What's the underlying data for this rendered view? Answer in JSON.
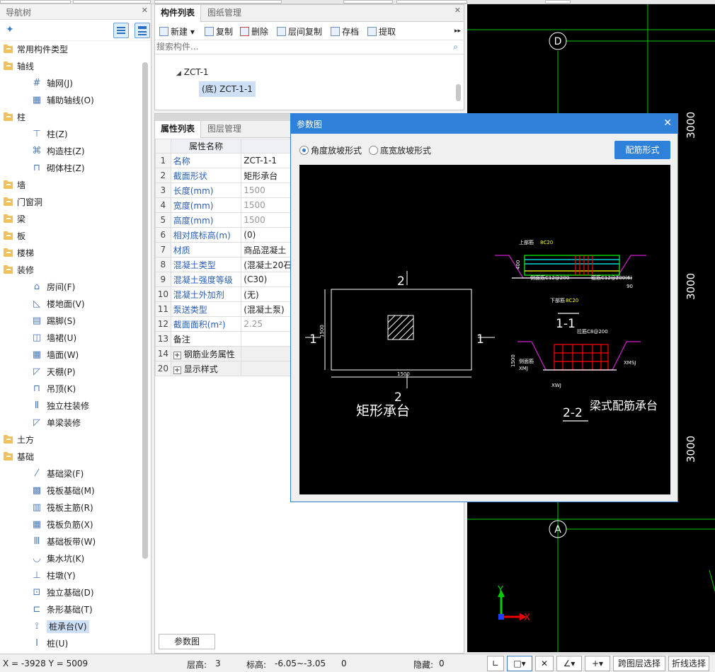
{
  "nav": {
    "title": "导航树",
    "items": [
      {
        "label": "常用构件类型",
        "level": 0
      },
      {
        "label": "轴线",
        "level": 0
      },
      {
        "label": "轴网(J)",
        "level": 1,
        "icon": "grid-icon"
      },
      {
        "label": "辅助轴线(O)",
        "level": 1,
        "icon": "aux-grid-icon"
      },
      {
        "label": "柱",
        "level": 0
      },
      {
        "label": "柱(Z)",
        "level": 1,
        "icon": "column-icon"
      },
      {
        "label": "构造柱(Z)",
        "level": 1,
        "icon": "structural-column-icon"
      },
      {
        "label": "砌体柱(Z)",
        "level": 1,
        "icon": "masonry-column-icon"
      },
      {
        "label": "墙",
        "level": 0
      },
      {
        "label": "门窗洞",
        "level": 0
      },
      {
        "label": "梁",
        "level": 0
      },
      {
        "label": "板",
        "level": 0
      },
      {
        "label": "楼梯",
        "level": 0
      },
      {
        "label": "装修",
        "level": 0
      },
      {
        "label": "房间(F)",
        "level": 1,
        "icon": "room-icon"
      },
      {
        "label": "楼地面(V)",
        "level": 1,
        "icon": "floor-icon"
      },
      {
        "label": "踢脚(S)",
        "level": 1,
        "icon": "skirting-icon"
      },
      {
        "label": "墙裙(U)",
        "level": 1,
        "icon": "dado-icon"
      },
      {
        "label": "墙面(W)",
        "level": 1,
        "icon": "wall-face-icon"
      },
      {
        "label": "天棚(P)",
        "level": 1,
        "icon": "ceiling-icon"
      },
      {
        "label": "吊顶(K)",
        "level": 1,
        "icon": "suspended-ceiling-icon"
      },
      {
        "label": "独立柱装修",
        "level": 1,
        "icon": "column-finish-icon"
      },
      {
        "label": "单梁装修",
        "level": 1,
        "icon": "beam-finish-icon"
      },
      {
        "label": "土方",
        "level": 0
      },
      {
        "label": "基础",
        "level": 0
      },
      {
        "label": "基础梁(F)",
        "level": 1,
        "icon": "foundation-beam-icon"
      },
      {
        "label": "筏板基础(M)",
        "level": 1,
        "icon": "raft-foundation-icon"
      },
      {
        "label": "筏板主筋(R)",
        "level": 1,
        "icon": "raft-main-rebar-icon"
      },
      {
        "label": "筏板负筋(X)",
        "level": 1,
        "icon": "raft-neg-rebar-icon"
      },
      {
        "label": "基础板带(W)",
        "level": 1,
        "icon": "foundation-strip-icon"
      },
      {
        "label": "集水坑(K)",
        "level": 1,
        "icon": "sump-pit-icon"
      },
      {
        "label": "柱墩(Y)",
        "level": 1,
        "icon": "column-pier-icon"
      },
      {
        "label": "独立基础(D)",
        "level": 1,
        "icon": "isolated-foundation-icon"
      },
      {
        "label": "条形基础(T)",
        "level": 1,
        "icon": "strip-foundation-icon"
      },
      {
        "label": "桩承台(V)",
        "level": 1,
        "icon": "pile-cap-icon",
        "selected": true
      },
      {
        "label": "桩(U)",
        "level": 1,
        "icon": "pile-icon"
      }
    ]
  },
  "components": {
    "tabs": [
      "构件列表",
      "图纸管理"
    ],
    "toolbar": [
      "新建",
      "复制",
      "删除",
      "层间复制",
      "存档",
      "提取"
    ],
    "search_placeholder": "搜索构件...",
    "tree_root": "ZCT-1",
    "tree_child": "(底) ZCT-1-1"
  },
  "properties": {
    "tabs": [
      "属性列表",
      "图层管理"
    ],
    "header": "属性名称",
    "rows": [
      {
        "num": "1",
        "name": "名称",
        "value": "ZCT-1-1",
        "blue": true
      },
      {
        "num": "2",
        "name": "截面形状",
        "value": "矩形承台",
        "blue": true
      },
      {
        "num": "3",
        "name": "长度(mm)",
        "value": "1500",
        "blue": true,
        "gray": true
      },
      {
        "num": "4",
        "name": "宽度(mm)",
        "value": "1500",
        "blue": true,
        "gray": true
      },
      {
        "num": "5",
        "name": "高度(mm)",
        "value": "1500",
        "blue": true,
        "gray": true
      },
      {
        "num": "6",
        "name": "相对底标高(m)",
        "value": "(0)",
        "blue": true
      },
      {
        "num": "7",
        "name": "材质",
        "value": "商品混凝土",
        "blue": true
      },
      {
        "num": "8",
        "name": "混凝土类型",
        "value": "(混凝土20石",
        "blue": true
      },
      {
        "num": "9",
        "name": "混凝土强度等级",
        "value": "(C30)",
        "blue": true
      },
      {
        "num": "10",
        "name": "混凝土外加剂",
        "value": "(无)",
        "blue": true
      },
      {
        "num": "11",
        "name": "泵送类型",
        "value": "(混凝土泵)",
        "blue": true
      },
      {
        "num": "12",
        "name": "截面面积(m²)",
        "value": "2.25",
        "blue": true,
        "gray": true
      },
      {
        "num": "13",
        "name": "备注",
        "value": "",
        "blue": false
      },
      {
        "num": "14",
        "name": "钢筋业务属性",
        "value": "",
        "blue": false,
        "group": true
      },
      {
        "num": "20",
        "name": "显示样式",
        "value": "",
        "blue": false,
        "group": true
      }
    ],
    "bottom_tab": "参数图"
  },
  "dialog": {
    "title": "参数图",
    "radio1": "角度放坡形式",
    "radio2": "底宽放坡形式",
    "button": "配筋形式",
    "drawing": {
      "left_caption": "矩形承台",
      "right_caption": "梁式配筋承台",
      "sec_top": "2",
      "sec_bottom": "2",
      "sec_left": "1",
      "sec_right": "1",
      "dim_side": "1500",
      "dim_bottom": "1500",
      "section_11": "1-1",
      "section_22": "2-2",
      "lbl_top_rebar": "上部筋",
      "lbl_top_rebar_val": "8C20",
      "lbl_side": "侧面筋C12@200",
      "lbl_stirrup": "箍筋C12@200(6)",
      "lbl_bottom_rebar": "下部筋",
      "lbl_bottom_rebar_val": "8C20",
      "lbl_tie": "拉筋C8@200",
      "lbl_side2": "侧面筋",
      "lbl_xmj": "XMJ",
      "lbl_xmsj": "XMSJ",
      "lbl_xwj": "XWJ",
      "lbl_dim_left": "1500",
      "lbl_dim_ze": "400",
      "lbl_90": "90"
    }
  },
  "cad": {
    "axis_d": "D",
    "axis_a": "A",
    "dim1": "3000",
    "dim2": "3000",
    "dim3": "3000",
    "ucs_x": "X",
    "ucs_y": "Y"
  },
  "status": {
    "coords": "X = -3928 Y = 5009",
    "floor_height_label": "层高:",
    "floor_height": "3",
    "elevation_label": "标高:",
    "elevation": "-6.05~-3.05",
    "zero": "0",
    "hidden_label": "隐藏:",
    "hidden": "0",
    "btn_cross_layer": "跨图层选择",
    "btn_polyline": "折线选择"
  }
}
